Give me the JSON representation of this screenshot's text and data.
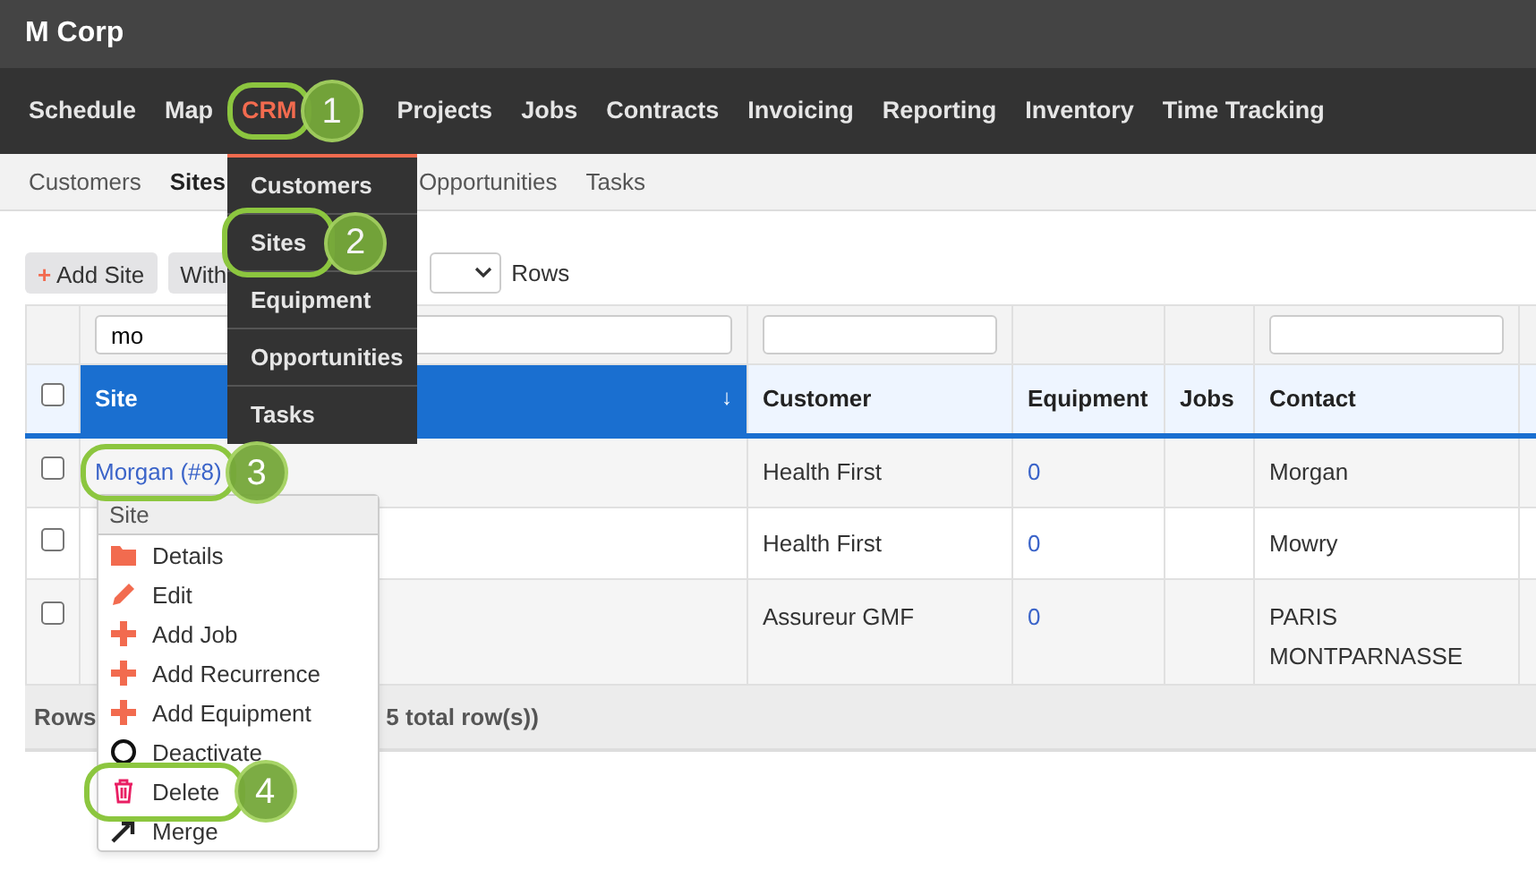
{
  "app": {
    "title": "M Corp"
  },
  "main_nav": [
    {
      "label": "Schedule",
      "selected": false
    },
    {
      "label": "Map",
      "selected": false
    },
    {
      "label": "CRM",
      "selected": true,
      "callout": "1"
    },
    {
      "label": "Projects",
      "selected": false
    },
    {
      "label": "Jobs",
      "selected": false
    },
    {
      "label": "Contracts",
      "selected": false
    },
    {
      "label": "Invoicing",
      "selected": false
    },
    {
      "label": "Reporting",
      "selected": false
    },
    {
      "label": "Inventory",
      "selected": false
    },
    {
      "label": "Time Tracking",
      "selected": false
    }
  ],
  "sub_nav": [
    {
      "label": "Customers",
      "selected": false
    },
    {
      "label": "Sites",
      "selected": true
    },
    {
      "label": "Opportunities",
      "selected": false
    },
    {
      "label": "Tasks",
      "selected": false
    }
  ],
  "crm_menu": [
    {
      "label": "Customers"
    },
    {
      "label": "Sites",
      "callout": "2"
    },
    {
      "label": "Equipment"
    },
    {
      "label": "Opportunities"
    },
    {
      "label": "Tasks"
    }
  ],
  "toolbar": {
    "add_button": "Add Site",
    "add_icon": "+",
    "filter_button": "With",
    "rows_label": "Rows"
  },
  "table": {
    "columns": [
      {
        "label": "Site",
        "selected": true,
        "sort_arrow": "↓",
        "filter_field": true,
        "filter_value": "mo"
      },
      {
        "label": "Customer",
        "selected": false,
        "filter_field": true
      },
      {
        "label": "Equipment",
        "selected": false
      },
      {
        "label": "Jobs",
        "selected": false
      },
      {
        "label": "Contact",
        "selected": false,
        "filter_field": true
      }
    ],
    "header_checked": false,
    "rows": [
      {
        "checked": false,
        "site": "Morgan (#8)",
        "callout": "3",
        "customer": "Health First",
        "equipment": "0",
        "contact": "Morgan"
      },
      {
        "checked": false,
        "customer": "Health First",
        "equipment": "0",
        "contact": "Mowry"
      },
      {
        "checked": false,
        "customer": "Assureur GMF",
        "equipment": "0",
        "contact": "PARIS MONTPARNASSE"
      }
    ],
    "footer": {
      "label": "Rows",
      "total": "5 total row(s))"
    }
  },
  "context_menu": {
    "header": "Site",
    "items": [
      {
        "label": "Details",
        "kind": "folder"
      },
      {
        "label": "Edit",
        "kind": "pencil"
      },
      {
        "label": "Add Job",
        "kind": "plus"
      },
      {
        "label": "Add Recurrence",
        "kind": "plus"
      },
      {
        "label": "Add Equipment",
        "kind": "plus"
      },
      {
        "label": "Deactivate",
        "kind": "circle"
      },
      {
        "label": "Delete",
        "kind": "trash",
        "callout": "4"
      },
      {
        "label": "Merge",
        "kind": "arrow"
      }
    ]
  }
}
